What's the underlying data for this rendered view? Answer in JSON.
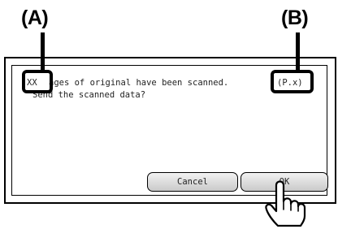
{
  "callouts": {
    "a_label": "(A)",
    "b_label": "(B)"
  },
  "message": {
    "count_placeholder": "XX",
    "line1_rest": "ages of original have been scanned.",
    "page_placeholder": "(P.x)",
    "line2": "Send the scanned data?"
  },
  "buttons": {
    "cancel_label": "Cancel",
    "ok_label": "OK"
  },
  "icons": {
    "pointer": "pointing-hand-icon"
  }
}
